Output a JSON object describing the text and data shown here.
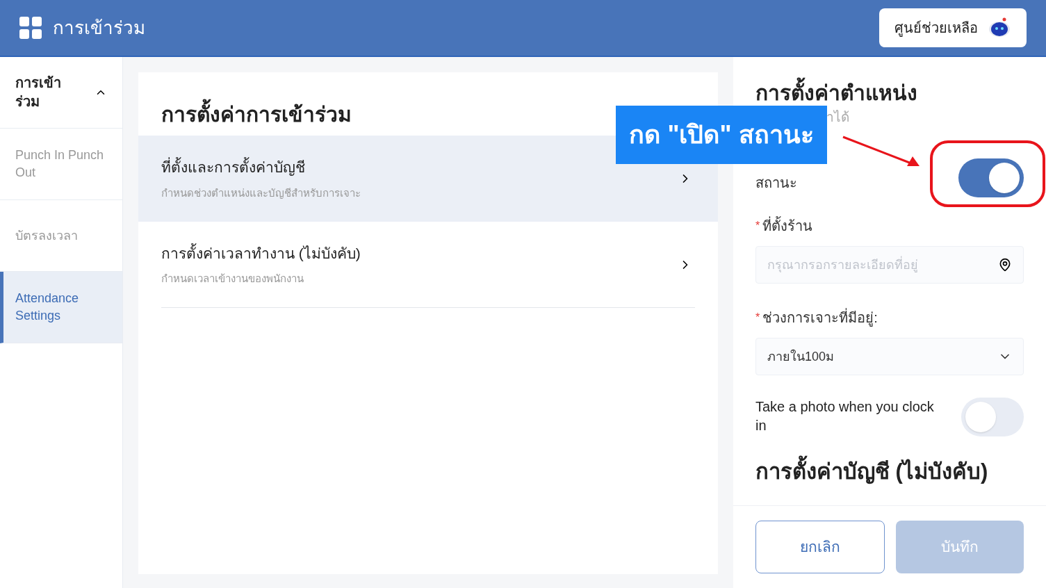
{
  "header": {
    "title": "การเข้าร่วม",
    "help_button": "ศูนย์ช่วยเหลือ"
  },
  "sidebar": {
    "group": {
      "label": "การเข้าร่วม",
      "expanded": true
    },
    "items": [
      {
        "label": "Punch In Punch Out",
        "selected": false
      },
      {
        "label": "บัตรลงเวลา",
        "selected": false
      },
      {
        "label": "Attendance Settings",
        "selected": true
      }
    ]
  },
  "main": {
    "title": "การตั้งค่าการเข้าร่วม",
    "items": [
      {
        "title": "ที่ตั้งและการตั้งค่าบัญชี",
        "subtitle": "กำหนดช่วงตำแหน่งและบัญชีสำหรับการเจาะ",
        "selected": true
      },
      {
        "title": "การตั้งค่าเวลาทำงาน (ไม่บังคับ)",
        "subtitle": "กำหนดเวลาเข้างานของพนักงาน",
        "selected": false
      }
    ]
  },
  "location_panel": {
    "title": "การตั้งค่าตำแหน่ง",
    "subtitle": "าได้",
    "status": {
      "label": "สถานะ",
      "on": true
    },
    "store_location": {
      "label": "ที่ตั้งร้าน",
      "required_mark": "*",
      "placeholder": "กรุณากรอกรายละเอียดที่อยู่"
    },
    "punch_range": {
      "label": "ช่วงการเจาะที่มีอยู่:",
      "required_mark": "*",
      "value": "ภายใน100ม"
    },
    "photo_toggle": {
      "label": "Take a photo when you clock in",
      "on": false
    },
    "account_title": "การตั้งค่าบัญชี (ไม่บังคับ)",
    "buttons": {
      "cancel": "ยกเลิก",
      "save": "บันทึก",
      "save_disabled": true
    }
  },
  "annotation": {
    "callout": "กด \"เปิด\" สถานะ"
  }
}
